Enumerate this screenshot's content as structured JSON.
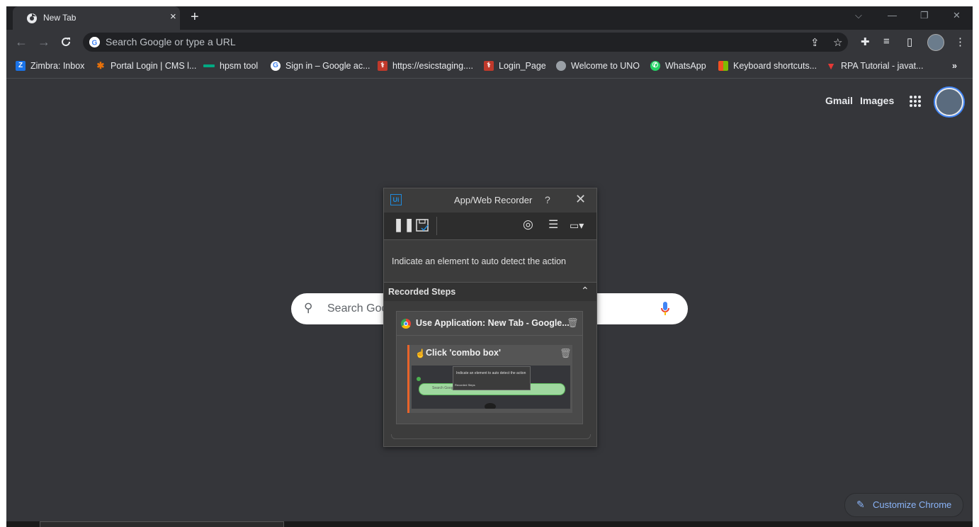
{
  "tab": {
    "title": "New Tab",
    "close": "×",
    "new_tab": "+"
  },
  "window_controls": {
    "search_tabs": "⌵",
    "minimize": "—",
    "restore": "❐",
    "close": "✕"
  },
  "toolbar": {
    "back": "←",
    "forward": "→",
    "reload": "C"
  },
  "omnibox": {
    "placeholder": "Search Google or type a URL"
  },
  "bookmarks": [
    {
      "label": "Zimbra: Inbox",
      "icon": "Z",
      "color": "#1a73e8"
    },
    {
      "label": "Portal Login | CMS l...",
      "icon": "✱",
      "color": "#e8710a"
    },
    {
      "label": "hpsm tool",
      "icon": "▭",
      "color": "#01a982"
    },
    {
      "label": "Sign in – Google ac...",
      "icon": "G",
      "color": "#ffffff"
    },
    {
      "label": "https://esicstaging....",
      "icon": "⚕",
      "color": "#c0392b"
    },
    {
      "label": "Login_Page",
      "icon": "⚕",
      "color": "#c0392b"
    },
    {
      "label": "Welcome to UNO",
      "icon": "◍",
      "color": "#9aa0a6"
    },
    {
      "label": "WhatsApp",
      "icon": "✆",
      "color": "#25d366"
    },
    {
      "label": "Keyboard shortcuts...",
      "icon": "▦",
      "color": "#f25022"
    },
    {
      "label": "RPA Tutorial - javat...",
      "icon": "▼",
      "color": "#e53935"
    }
  ],
  "bookmarks_more": "»",
  "ntp": {
    "gmail": "Gmail",
    "images": "Images",
    "search_placeholder": "Search Goo",
    "customize": "Customize Chrome"
  },
  "recorder": {
    "logo": "Ui",
    "title": "App/Web Recorder",
    "help": "?",
    "close": "✕",
    "hint": "Indicate an element to auto detect the action",
    "steps_header": "Recorded Steps",
    "collapse": "⌃",
    "step1_title": "Use Application: New Tab - Google...",
    "step2_title": "Click 'combo box'",
    "thumb_hint": "Indicate an element to auto detect the action",
    "thumb_steps": "Recorded Steps",
    "thumb_search": "Search Google or type a URL"
  }
}
